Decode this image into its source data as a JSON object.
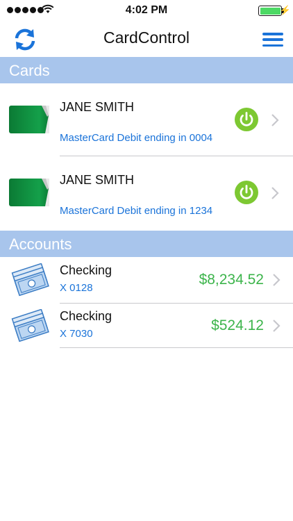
{
  "status_bar": {
    "time": "4:02 PM",
    "signal_bars": 5,
    "battery_level": 1.0
  },
  "nav": {
    "title": "CardControl",
    "left_icon": "refresh-icon",
    "right_icon": "menu-icon"
  },
  "sections": {
    "cards_label": "Cards",
    "accounts_label": "Accounts"
  },
  "cards": [
    {
      "name": "JANE SMITH",
      "description": "MasterCard Debit ending in 0004",
      "enabled": true
    },
    {
      "name": "JANE SMITH",
      "description": "MasterCard Debit ending in 1234",
      "enabled": true
    }
  ],
  "accounts": [
    {
      "name": "Checking",
      "number": "X 0128",
      "balance": "$8,234.52"
    },
    {
      "name": "Checking",
      "number": "X 7030",
      "balance": "$524.12"
    }
  ],
  "colors": {
    "accent_blue": "#1a73d9",
    "section_header": "#a8c5ec",
    "balance_green": "#3cb44b",
    "power_green": "#7dc832",
    "card_green": "#0e8a3c"
  }
}
